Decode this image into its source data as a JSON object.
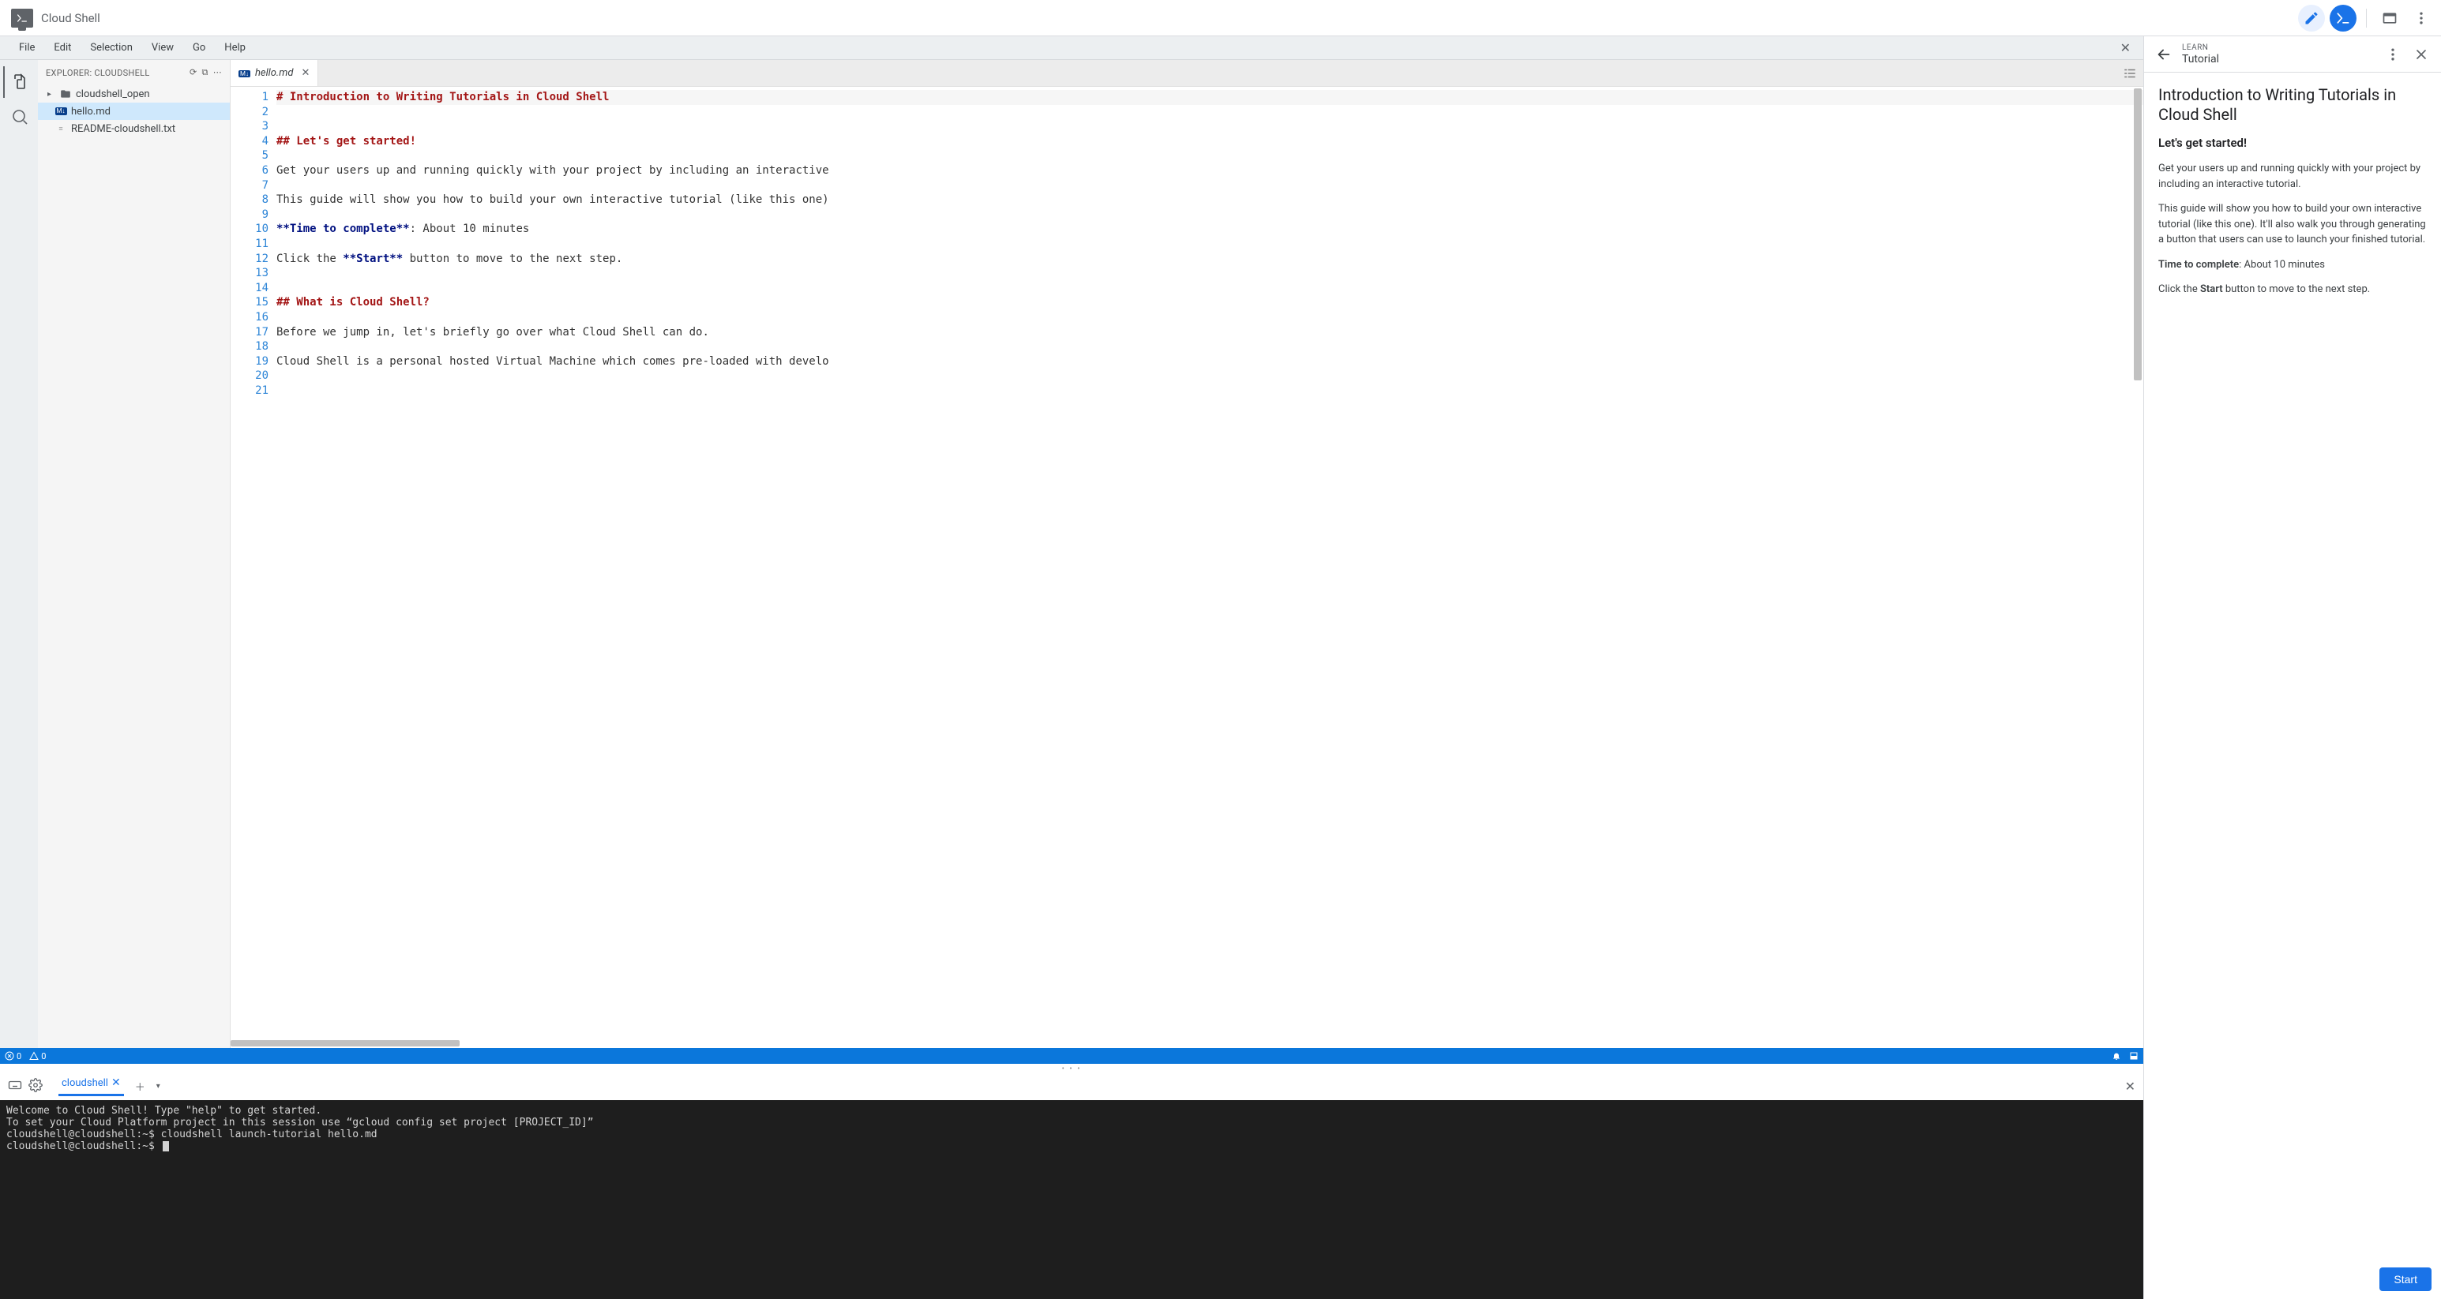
{
  "app": {
    "title": "Cloud Shell"
  },
  "topbar_icons": [
    "pencil",
    "console",
    "window",
    "more"
  ],
  "menubar": [
    "File",
    "Edit",
    "Selection",
    "View",
    "Go",
    "Help"
  ],
  "explorer": {
    "title": "EXPLORER: CLOUDSHELL",
    "tree": [
      {
        "name": "cloudshell_open",
        "type": "folder",
        "depth": 0
      },
      {
        "name": "hello.md",
        "type": "md",
        "depth": 1,
        "selected": true
      },
      {
        "name": "README-cloudshell.txt",
        "type": "txt",
        "depth": 1
      }
    ]
  },
  "tab": {
    "name": "hello.md"
  },
  "code": {
    "lines": [
      {
        "n": 1,
        "kind": "h1",
        "text": "# Introduction to Writing Tutorials in Cloud Shell"
      },
      {
        "n": 2,
        "kind": "",
        "text": ""
      },
      {
        "n": 3,
        "kind": "",
        "text": ""
      },
      {
        "n": 4,
        "kind": "h2",
        "text": "## Let's get started!"
      },
      {
        "n": 5,
        "kind": "",
        "text": ""
      },
      {
        "n": 6,
        "kind": "",
        "text": "Get your users up and running quickly with your project by including an interactive"
      },
      {
        "n": 7,
        "kind": "",
        "text": ""
      },
      {
        "n": 8,
        "kind": "",
        "text": "This guide will show you how to build your own interactive tutorial (like this one)"
      },
      {
        "n": 9,
        "kind": "",
        "text": ""
      },
      {
        "n": 10,
        "kind": "mix",
        "bold": "**Time to complete**",
        "rest": ": About 10 minutes"
      },
      {
        "n": 11,
        "kind": "",
        "text": ""
      },
      {
        "n": 12,
        "kind": "mix2",
        "pre": "Click the ",
        "bold": "**Start**",
        "rest": " button to move to the next step."
      },
      {
        "n": 13,
        "kind": "",
        "text": ""
      },
      {
        "n": 14,
        "kind": "",
        "text": ""
      },
      {
        "n": 15,
        "kind": "h2",
        "text": "## What is Cloud Shell?"
      },
      {
        "n": 16,
        "kind": "",
        "text": ""
      },
      {
        "n": 17,
        "kind": "",
        "text": "Before we jump in, let's briefly go over what Cloud Shell can do."
      },
      {
        "n": 18,
        "kind": "",
        "text": ""
      },
      {
        "n": 19,
        "kind": "",
        "text": "Cloud Shell is a personal hosted Virtual Machine which comes pre-loaded with develo"
      },
      {
        "n": 20,
        "kind": "",
        "text": ""
      },
      {
        "n": 21,
        "kind": "",
        "text": ""
      }
    ]
  },
  "status": {
    "errors": "0",
    "warnings": "0"
  },
  "terminal": {
    "tab": "cloudshell",
    "lines": [
      "Welcome to Cloud Shell! Type \"help\" to get started.",
      "To set your Cloud Platform project in this session use “gcloud config set project [PROJECT_ID]”",
      "cloudshell@cloudshell:~$ cloudshell launch-tutorial hello.md",
      "cloudshell@cloudshell:~$ "
    ]
  },
  "tutorial": {
    "overline": "LEARN",
    "header_title": "Tutorial",
    "h1": "Introduction to Writing Tutorials in Cloud Shell",
    "h2": "Let's get started!",
    "p1": "Get your users up and running quickly with your project by including an interactive tutorial.",
    "p2": "This guide will show you how to build your own interactive tutorial (like this one). It'll also walk you through generating a button that users can use to launch your finished tutorial.",
    "time_label": "Time to complete",
    "time_value": ": About 10 minutes",
    "p4a": "Click the ",
    "p4b": "Start",
    "p4c": " button to move to the next step.",
    "start": "Start"
  }
}
